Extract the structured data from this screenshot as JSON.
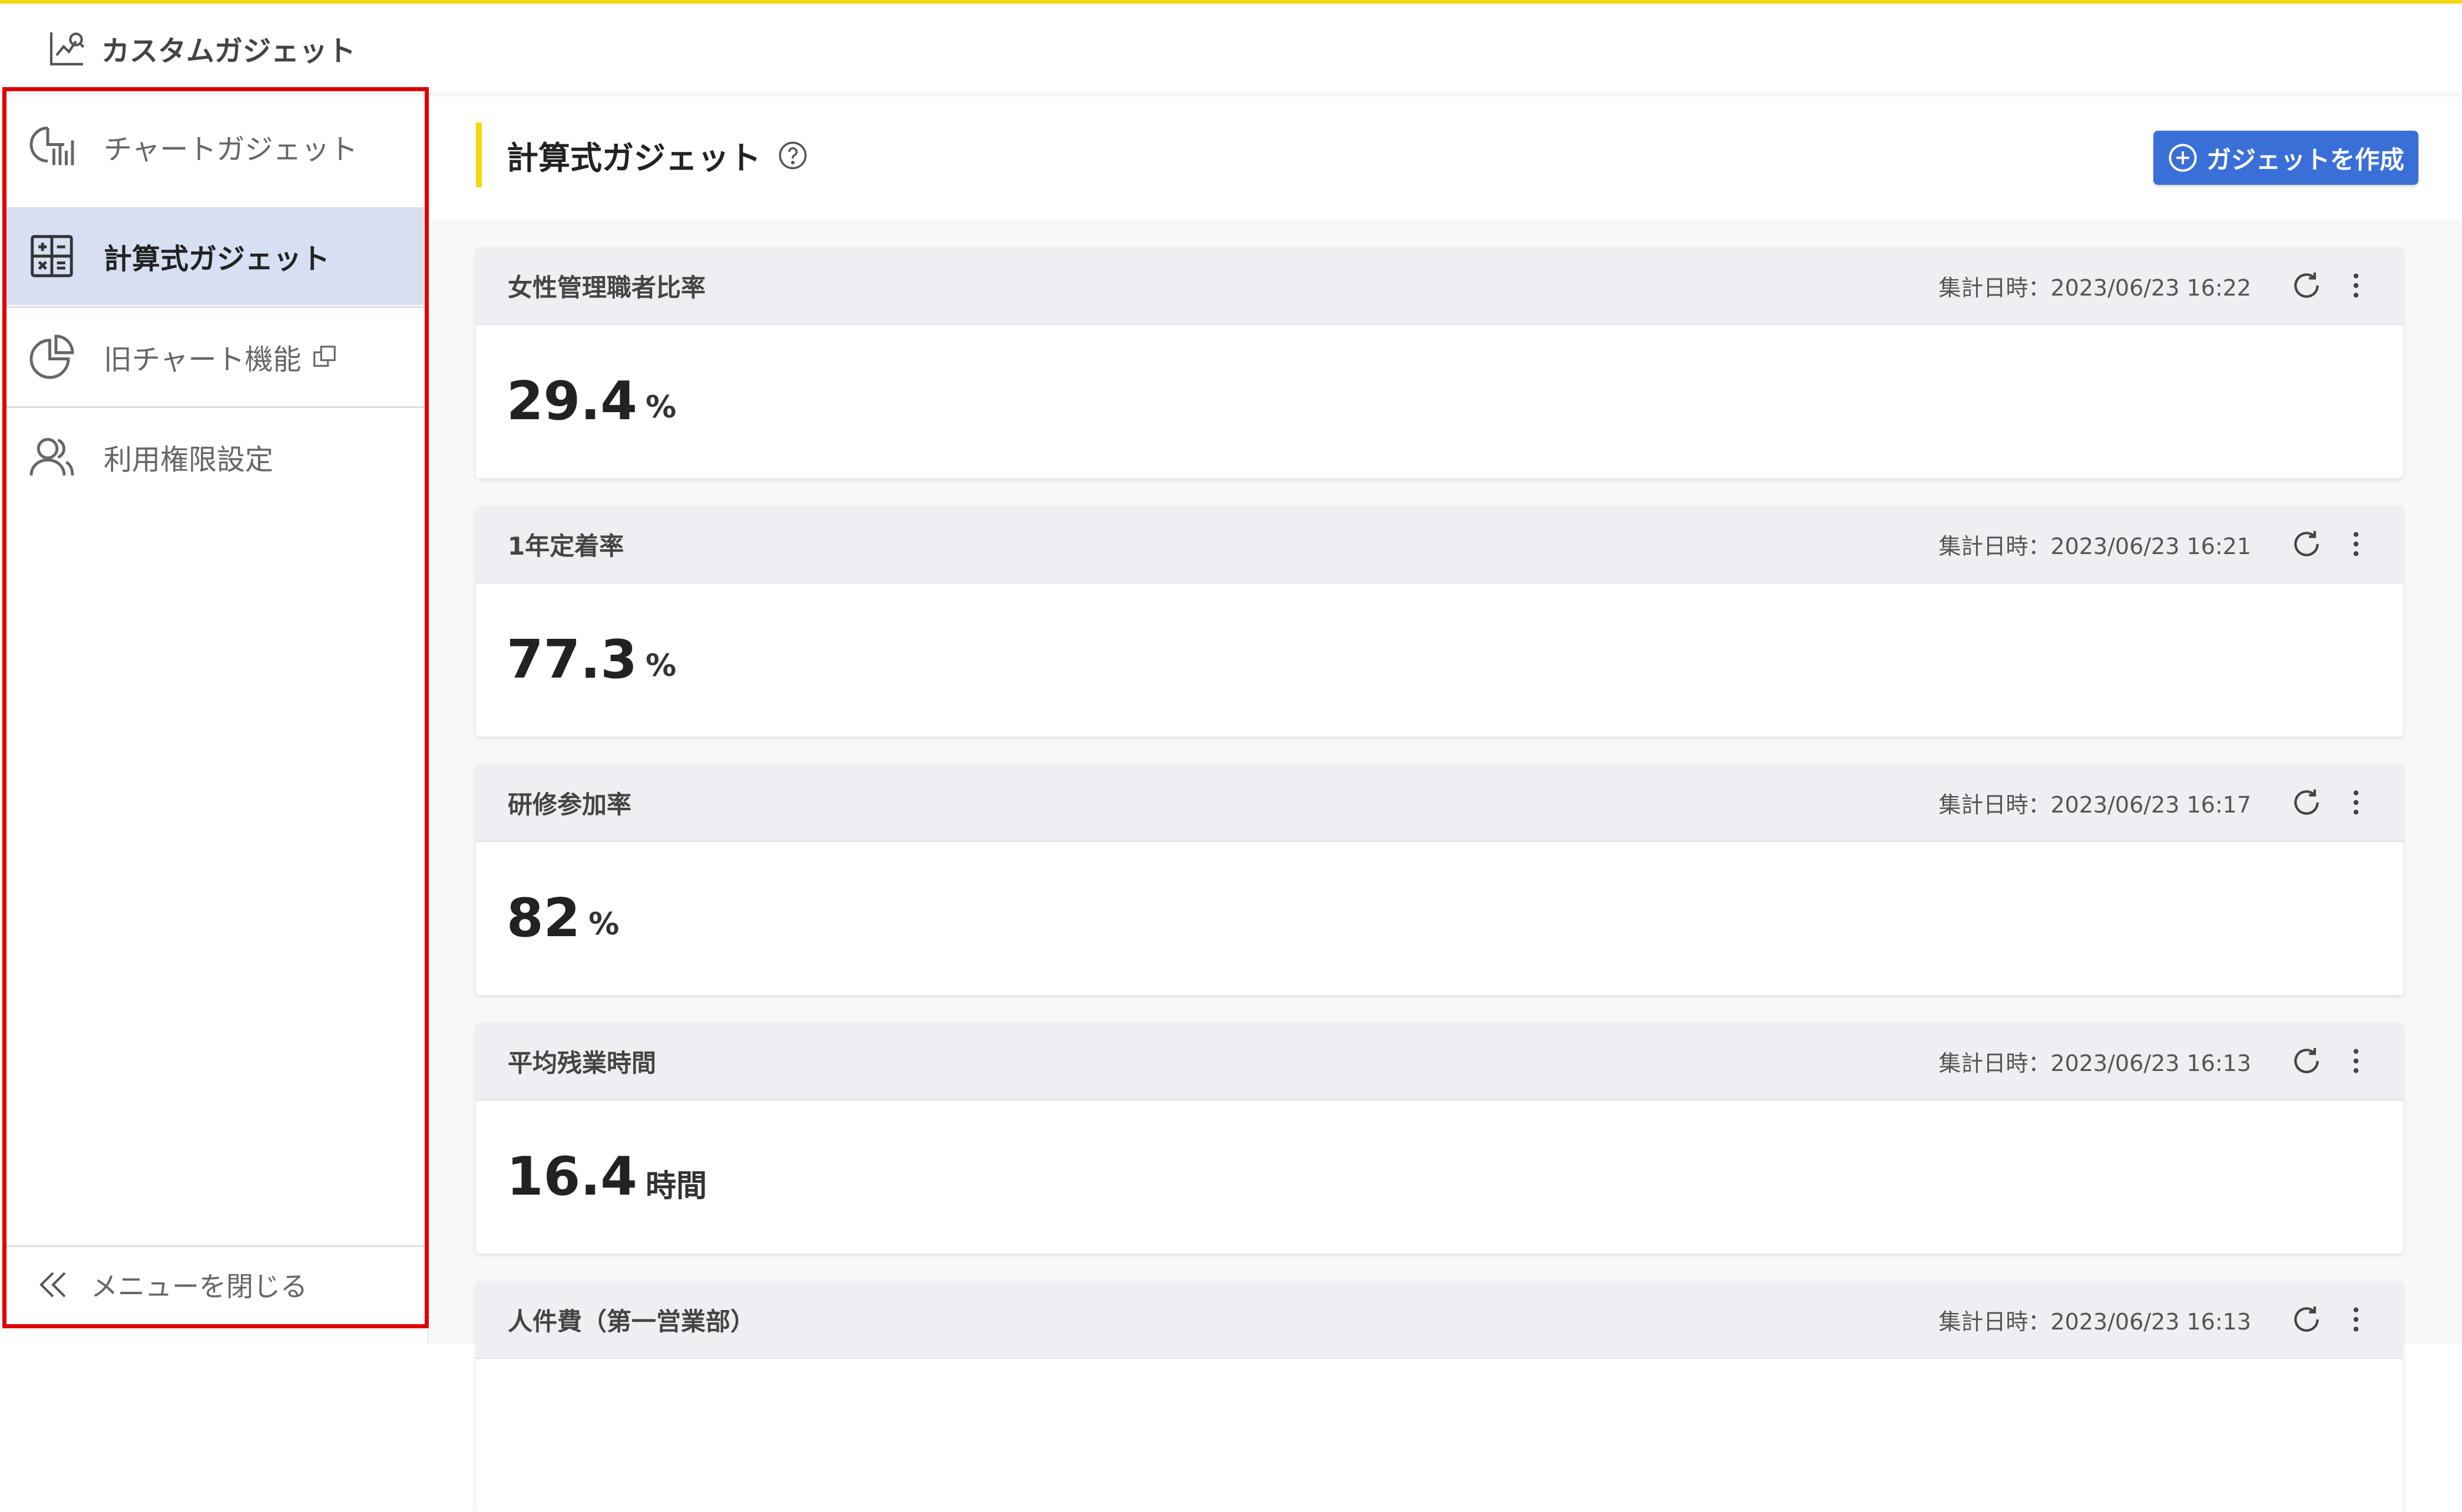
{
  "app": {
    "title": "カスタムガジェット",
    "accent_color": "#f5d90a",
    "primary_color": "#3a6fd8"
  },
  "sidebar": {
    "items": [
      {
        "label": "チャートガジェット",
        "icon": "chart-gadget-icon",
        "active": false
      },
      {
        "label": "計算式ガジェット",
        "icon": "calculator-icon",
        "active": true
      },
      {
        "label": "旧チャート機能",
        "icon": "pie-chart-icon",
        "active": false,
        "external": true
      },
      {
        "label": "利用権限設定",
        "icon": "users-icon",
        "active": false
      }
    ],
    "close_label": "メニューを閉じる"
  },
  "main": {
    "heading": "計算式ガジェット",
    "create_button": "ガジェットを作成",
    "cards": [
      {
        "title": "女性管理職者比率",
        "time": "集計日時：2023/06/23 16:22",
        "value": "29.4",
        "unit": "%"
      },
      {
        "title": "1年定着率",
        "time": "集計日時：2023/06/23 16:21",
        "value": "77.3",
        "unit": "%"
      },
      {
        "title": "研修参加率",
        "time": "集計日時：2023/06/23 16:17",
        "value": "82",
        "unit": "%"
      },
      {
        "title": "平均残業時間",
        "time": "集計日時：2023/06/23 16:13",
        "value": "16.4",
        "unit": "時間"
      },
      {
        "title": "人件費（第一営業部）",
        "time": "集計日時：2023/06/23 16:13",
        "value": "",
        "unit": ""
      }
    ]
  }
}
